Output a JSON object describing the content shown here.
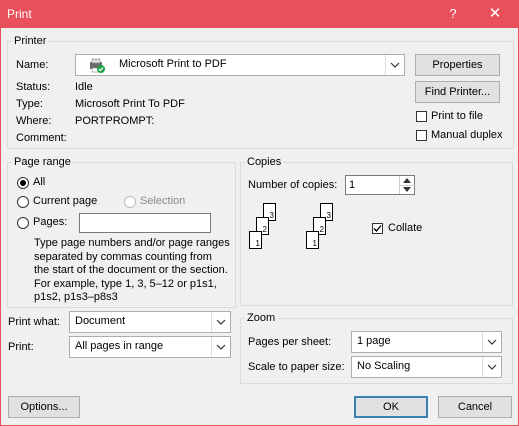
{
  "window": {
    "title": "Print",
    "help_glyph": "?",
    "close_glyph": "✕"
  },
  "printer": {
    "group_label": "Printer",
    "name_label": "Name:",
    "name_value": "Microsoft Print to PDF",
    "status_label": "Status:",
    "status_value": "Idle",
    "type_label": "Type:",
    "type_value": "Microsoft Print To PDF",
    "where_label": "Where:",
    "where_value": "PORTPROMPT:",
    "comment_label": "Comment:",
    "comment_value": "",
    "properties_button": "Properties",
    "find_printer_button": "Find Printer...",
    "print_to_file_label": "Print to file",
    "manual_duplex_label": "Manual duplex"
  },
  "page_range": {
    "group_label": "Page range",
    "all_label": "All",
    "current_page_label": "Current page",
    "selection_label": "Selection",
    "pages_label": "Pages:",
    "pages_value": "",
    "help_text": "Type page numbers and/or page ranges separated by commas counting from the start of the document or the section. For example, type 1, 3, 5–12 or p1s1, p1s2, p1s3–p8s3"
  },
  "copies": {
    "group_label": "Copies",
    "number_label": "Number of copies:",
    "number_value": "1",
    "collate_label": "Collate",
    "collate_checked": true,
    "page_numbers": [
      "3",
      "2",
      "1"
    ]
  },
  "print_what": {
    "label": "Print what:",
    "value": "Document"
  },
  "print": {
    "label": "Print:",
    "value": "All pages in range"
  },
  "zoom": {
    "group_label": "Zoom",
    "pages_per_sheet_label": "Pages per sheet:",
    "pages_per_sheet_value": "1 page",
    "scale_label": "Scale to paper size:",
    "scale_value": "No Scaling"
  },
  "footer": {
    "options_button": "Options...",
    "ok_button": "OK",
    "cancel_button": "Cancel"
  },
  "colors": {
    "titlebar": "#e8505b",
    "default_button_border": "#3c7fb1"
  }
}
